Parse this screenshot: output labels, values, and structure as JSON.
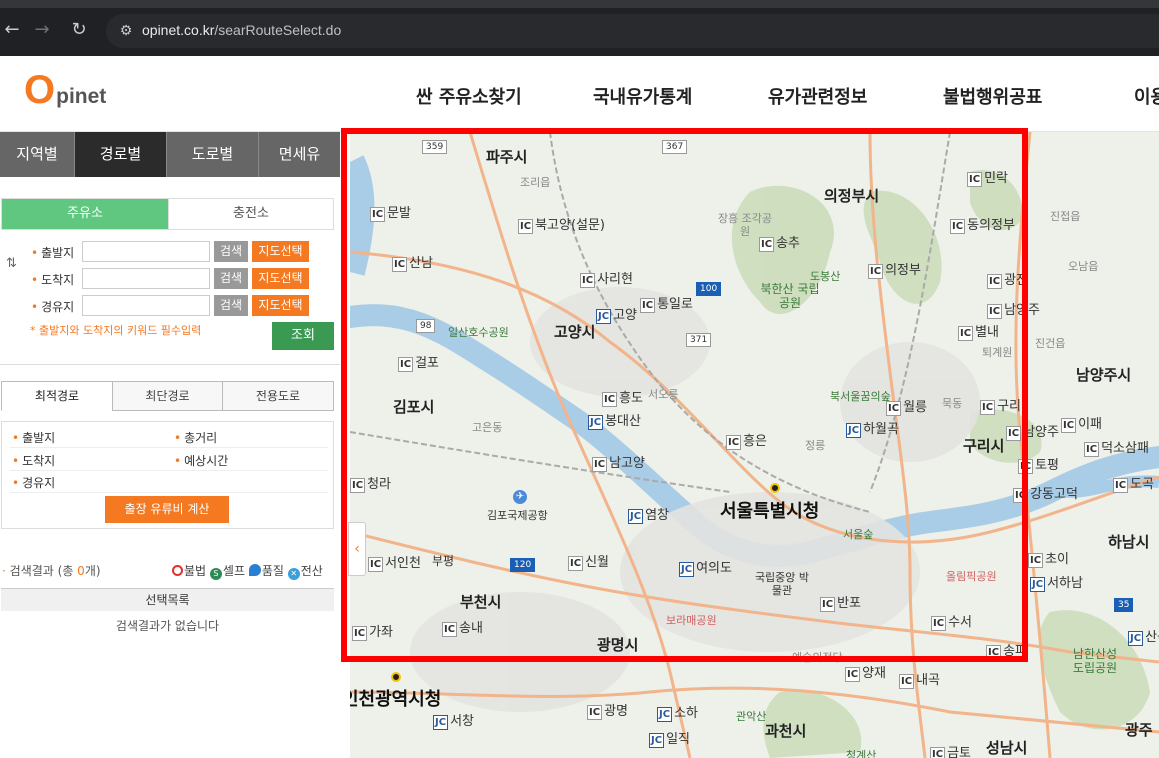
{
  "browser": {
    "url_host": "opinet.co.kr",
    "url_path": "/searRouteSelect.do",
    "icons": [
      "back-arrow-icon",
      "forward-arrow-icon",
      "reload-icon",
      "site-info-icon"
    ]
  },
  "header": {
    "logo_o": "O",
    "logo_rest": "pinet",
    "nav": [
      "싼 주유소찾기",
      "국내유가통계",
      "유가관련정보",
      "불법행위공표",
      "이용"
    ]
  },
  "panel": {
    "tabs": [
      "지역별",
      "경로별",
      "도로별",
      "면세유"
    ],
    "active_tab": "경로별",
    "subtabs": [
      "주유소",
      "충전소"
    ],
    "form": {
      "rows": [
        {
          "label": "출발지",
          "value": ""
        },
        {
          "label": "도착지",
          "value": ""
        },
        {
          "label": "경유지",
          "value": ""
        }
      ],
      "search_label": "검색",
      "map_select_label": "지도선택",
      "notice": "* 출발지와 도착지의 키워드 필수입력",
      "lookup_label": "조회"
    },
    "route_tabs": [
      "최적경로",
      "최단경로",
      "전용도로"
    ],
    "summary": {
      "start": "출발지",
      "total_distance": "총거리",
      "end": "도착지",
      "eta": "예상시간",
      "waypoint": "경유지",
      "cost_button": "출장 유류비 계산"
    },
    "result": {
      "prefix": "검색결과 (총 ",
      "count": "0",
      "suffix": "개)"
    },
    "legend": [
      "불법",
      "셀프",
      "품질",
      "전산"
    ],
    "list_header": "선택목록",
    "empty_message": "검색결과가 없습니다"
  },
  "map": {
    "cities": {
      "seoul": "서울특별시청",
      "goyang": "고양시",
      "gimpo": "김포시",
      "uijeongbu": "의정부시",
      "guri": "구리시",
      "namyangju": "남양주시",
      "bucheon": "부천시",
      "gwangmyeong": "광명시",
      "hanam": "하남시",
      "incheon": "인천광역시청",
      "gwacheon": "과천시",
      "seongnam": "성남시",
      "gwangju": "광주",
      "paju": "파주시"
    },
    "ics": [
      {
        "type": "IC",
        "name": "문발"
      },
      {
        "type": "IC",
        "name": "산남"
      },
      {
        "type": "IC",
        "name": "북고양(설문)"
      },
      {
        "type": "IC",
        "name": "사리현"
      },
      {
        "type": "JC",
        "name": "고양"
      },
      {
        "type": "IC",
        "name": "통일로"
      },
      {
        "type": "IC",
        "name": "송추"
      },
      {
        "type": "IC",
        "name": "의정부"
      },
      {
        "type": "IC",
        "name": "민락"
      },
      {
        "type": "IC",
        "name": "동의정부"
      },
      {
        "type": "IC",
        "name": "광전"
      },
      {
        "type": "IC",
        "name": "남양주"
      },
      {
        "type": "IC",
        "name": "별내"
      },
      {
        "type": "IC",
        "name": "걸포"
      },
      {
        "type": "IC",
        "name": "흥도"
      },
      {
        "type": "JC",
        "name": "봉대산"
      },
      {
        "type": "IC",
        "name": "남고양"
      },
      {
        "type": "IC",
        "name": "흥은"
      },
      {
        "type": "JC",
        "name": "하월곡"
      },
      {
        "type": "IC",
        "name": "월릉"
      },
      {
        "type": "IC",
        "name": "구리"
      },
      {
        "type": "IC",
        "name": "남양주"
      },
      {
        "type": "IC",
        "name": "토평"
      },
      {
        "type": "IC",
        "name": "이패"
      },
      {
        "type": "IC",
        "name": "덕소삼패"
      },
      {
        "type": "IC",
        "name": "강동고덕"
      },
      {
        "type": "IC",
        "name": "도곡"
      },
      {
        "type": "IC",
        "name": "청라"
      },
      {
        "type": "JC",
        "name": "염창"
      },
      {
        "type": "IC",
        "name": "서인천"
      },
      {
        "type": "IC",
        "name": "신월"
      },
      {
        "type": "JC",
        "name": "여의도"
      },
      {
        "type": "IC",
        "name": "반포"
      },
      {
        "type": "IC",
        "name": "수서"
      },
      {
        "type": "IC",
        "name": "송파"
      },
      {
        "type": "IC",
        "name": "초이"
      },
      {
        "type": "JC",
        "name": "서하남"
      },
      {
        "type": "IC",
        "name": "가좌"
      },
      {
        "type": "IC",
        "name": "송내"
      },
      {
        "type": "JC",
        "name": "서창"
      },
      {
        "type": "IC",
        "name": "광명"
      },
      {
        "type": "JC",
        "name": "소하"
      },
      {
        "type": "JC",
        "name": "일직"
      },
      {
        "type": "IC",
        "name": "내곡"
      },
      {
        "type": "IC",
        "name": "금토"
      },
      {
        "type": "JC",
        "name": "산곡"
      },
      {
        "type": "IC",
        "name": "양재"
      }
    ],
    "places": {
      "joriup": "조리읍",
      "janghung": "장흥 조각공원",
      "dobong": "도봉산",
      "bukhansan": "북한산 국립공원",
      "ilsan_park": "일산호수공원",
      "seooreung": "서오릉",
      "bukseoul": "북서울꿈의숲",
      "mukdong": "묵동",
      "gimpo_airport": "김포국제공항",
      "seoul_forest": "서울숲",
      "museum": "국립중앙 박물관",
      "olympic": "올림픽공원",
      "boramae": "보라매공원",
      "jungneung": "정릉",
      "gwanaksan": "관악산",
      "namhansan": "남한산성 도립공원",
      "jinjeop": "진접읍",
      "ohnam": "오남읍",
      "jinkeon": "진건읍",
      "toegyewon": "퇴계원",
      "goeun": "고은동",
      "cheonggye": "청계산",
      "bucheon_pyeong": "부평",
      "yesul": "예술의전당"
    },
    "shields": [
      "359",
      "367",
      "100",
      "98",
      "371",
      "120",
      "35"
    ],
    "toggle_icon": "chevron-left-icon"
  }
}
